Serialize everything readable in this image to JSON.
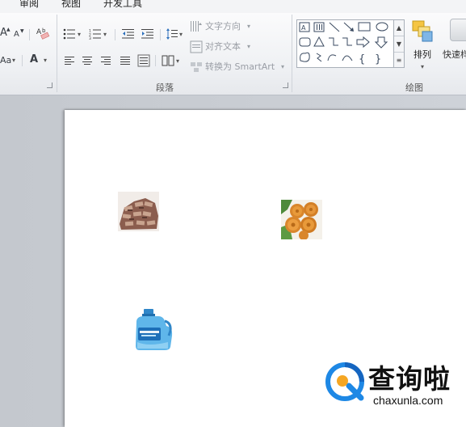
{
  "menu_tabs": [
    {
      "label": "审阅"
    },
    {
      "label": "视图"
    },
    {
      "label": "开发工具"
    }
  ],
  "ribbon": {
    "font_group": {
      "grow_label": "A",
      "shrink_label": "A",
      "case_label": "Aa",
      "color_label": "A"
    },
    "paragraph_group": {
      "label": "段落",
      "text_direction": "文字方向",
      "align_text": "对齐文本",
      "convert_smartart": "转换为 SmartArt"
    },
    "drawing_group": {
      "label": "绘图",
      "arrange_label": "排列",
      "quick_styles_label": "快速样"
    }
  },
  "watermark": {
    "title": "查询啦",
    "url": "chaxunla.com",
    "accent_color": "#1e88e5",
    "logo_color": "#f5a623"
  },
  "colors": {
    "ribbon_bg": "#eef0f3",
    "workspace_bg": "#c9cdd3",
    "page_bg": "#ffffff"
  }
}
